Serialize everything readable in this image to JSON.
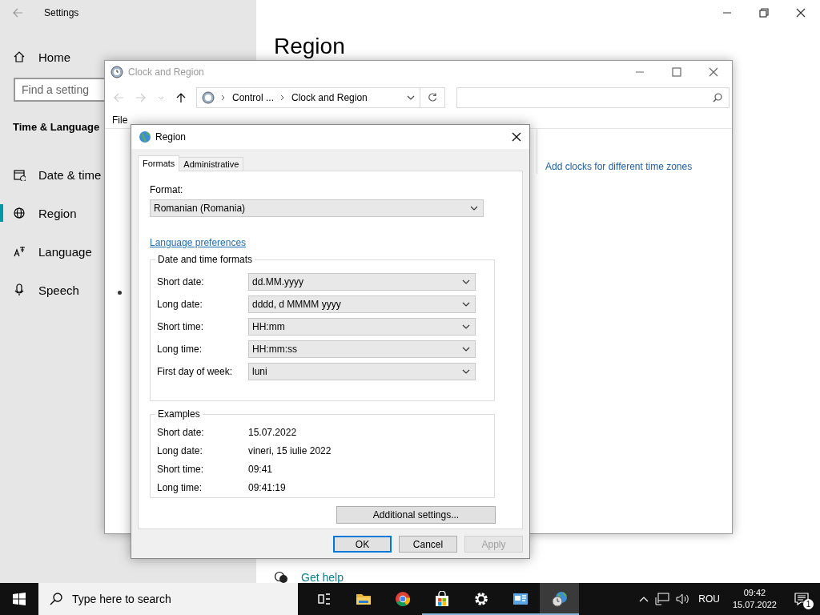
{
  "settings": {
    "title": "Settings",
    "home": "Home",
    "search": {
      "placeholder": "Find a setting"
    },
    "section": "Time & Language",
    "nav": [
      {
        "label": "Date & time",
        "kind": "calendar",
        "selected": false
      },
      {
        "label": "Region",
        "kind": "globe",
        "selected": true
      },
      {
        "label": "Language",
        "kind": "language",
        "selected": false
      },
      {
        "label": "Speech",
        "kind": "mic",
        "selected": false
      }
    ],
    "heading": "Region",
    "help_link": "Get help"
  },
  "control_panel": {
    "title": "Clock and Region",
    "breadcrumb": [
      "Control ...",
      "Clock and Region"
    ],
    "menu": [
      "File"
    ],
    "link": "Add clocks for different time zones"
  },
  "region_dialog": {
    "title": "Region",
    "tabs": [
      {
        "label": "Formats",
        "selected": true
      },
      {
        "label": "Administrative",
        "selected": false
      }
    ],
    "format": {
      "label": "Format:",
      "value": "Romanian (Romania)"
    },
    "language_link": "Language preferences",
    "formats_group": {
      "title": "Date and time formats",
      "rows": [
        {
          "label": "Short date:",
          "value": "dd.MM.yyyy"
        },
        {
          "label": "Long date:",
          "value": "dddd, d MMMM yyyy"
        },
        {
          "label": "Short time:",
          "value": "HH:mm"
        },
        {
          "label": "Long time:",
          "value": "HH:mm:ss"
        },
        {
          "label": "First day of week:",
          "value": "luni"
        }
      ]
    },
    "examples_group": {
      "title": "Examples",
      "rows": [
        {
          "label": "Short date:",
          "value": "15.07.2022"
        },
        {
          "label": "Long date:",
          "value": "vineri, 15 iulie 2022"
        },
        {
          "label": "Short time:",
          "value": "09:41"
        },
        {
          "label": "Long time:",
          "value": "09:41:19"
        }
      ]
    },
    "additional_button": "Additional settings...",
    "buttons": [
      {
        "label": "OK",
        "default": true,
        "disabled": false
      },
      {
        "label": "Cancel",
        "default": false,
        "disabled": false
      },
      {
        "label": "Apply",
        "default": false,
        "disabled": true
      }
    ]
  },
  "taskbar": {
    "search": {
      "placeholder": "Type here to search"
    },
    "apps": [
      {
        "kind": "taskview",
        "running": false,
        "active": false
      },
      {
        "kind": "folder",
        "running": false,
        "active": false
      },
      {
        "kind": "chrome",
        "running": false,
        "active": false
      },
      {
        "kind": "store",
        "running": true,
        "active": false
      },
      {
        "kind": "gear",
        "running": true,
        "active": false
      },
      {
        "kind": "panel",
        "running": true,
        "active": false
      },
      {
        "kind": "clockglobe",
        "running": true,
        "active": true
      }
    ],
    "language": "ROU",
    "time": "09:42",
    "date": "15.07.2022",
    "notifications": "1"
  }
}
